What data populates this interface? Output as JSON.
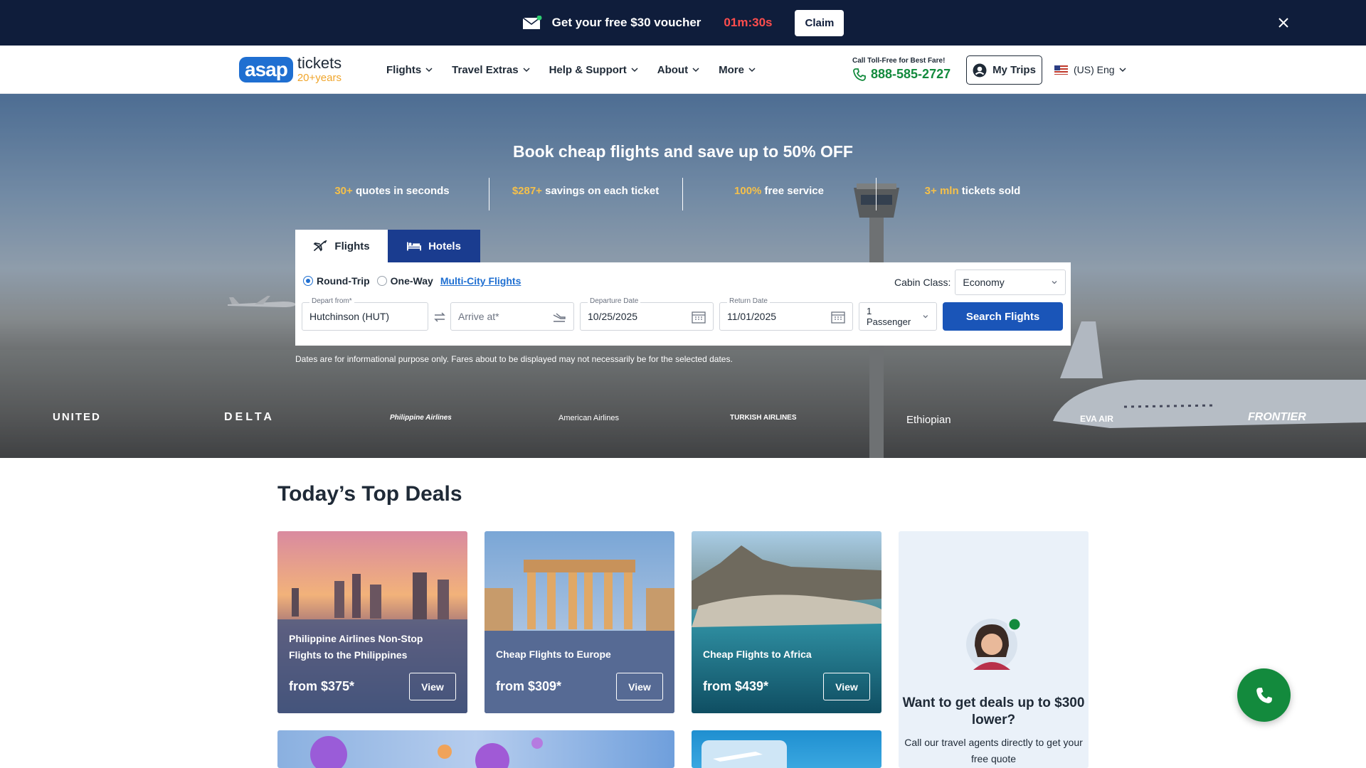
{
  "promo": {
    "message": "Get your free $30 voucher",
    "timer": "01m:30s",
    "claim_label": "Claim"
  },
  "header": {
    "logo_word": "asap",
    "logo_tickets": "tickets",
    "logo_years": "20+years",
    "nav": [
      "Flights",
      "Travel Extras",
      "Help & Support",
      "About",
      "More"
    ],
    "call_label": "Call Toll-Free for Best Fare!",
    "phone": "888-585-2727",
    "my_trips": "My Trips",
    "language": "(US) Eng"
  },
  "hero": {
    "headline": "Book cheap flights and save up to 50% OFF",
    "stats": [
      {
        "highlight": "30+",
        "text": " quotes in seconds"
      },
      {
        "highlight": "$287+",
        "text": " savings on each ticket"
      },
      {
        "highlight": "100%",
        "text": " free service"
      },
      {
        "highlight": "3+ mln",
        "text": " tickets sold"
      }
    ],
    "tabs": [
      "Flights",
      "Hotels"
    ],
    "trip_types": [
      "Round-Trip",
      "One-Way",
      "Multi-City Flights"
    ],
    "cabin_label": "Cabin Class:",
    "cabin_value": "Economy",
    "depart_label": "Depart from*",
    "depart_value": "Hutchinson (HUT)",
    "arrive_placeholder": "Arrive at*",
    "departure_date_label": "Departure Date",
    "departure_date": "10/25/2025",
    "return_date_label": "Return Date",
    "return_date": "11/01/2025",
    "passengers": "1 Passenger",
    "search_label": "Search Flights",
    "disclaimer": "Dates are for informational purpose only. Fares about to be displayed may not necessarily be for the selected dates.",
    "airlines": [
      "UNITED",
      "DELTA",
      "Philippine Airlines",
      "American Airlines",
      "TURKISH AIRLINES",
      "Ethiopian",
      "EVA AIR",
      "FRONTIER"
    ]
  },
  "deals": {
    "title": "Today’s Top Deals",
    "cards": [
      {
        "title": "Philippine Airlines Non-Stop Flights to the Philippines",
        "price": "from $375*",
        "view": "View"
      },
      {
        "title": "Cheap Flights to Europe",
        "price": "from $309*",
        "view": "View"
      },
      {
        "title": "Cheap Flights to Africa",
        "price": "from $439*",
        "view": "View"
      }
    ],
    "agent": {
      "heading": "Want to get deals up to $300 lower?",
      "text": "Call our travel agents directly to get your free quote"
    }
  },
  "colors": {
    "promo_bg": "#0f1d3b",
    "timer": "#ff4d4d",
    "brand_blue": "#1f6fd1",
    "search_button": "#1a55b8",
    "phone_green": "#138a3d",
    "highlight_yellow": "#f5c04a"
  },
  "icons": [
    "envelope-icon",
    "close-icon",
    "chevron-down-icon",
    "phone-icon",
    "user-icon",
    "us-flag-icon",
    "plane-icon",
    "bed-icon",
    "swap-icon",
    "arrival-plane-icon",
    "calendar-icon",
    "agent-avatar"
  ]
}
